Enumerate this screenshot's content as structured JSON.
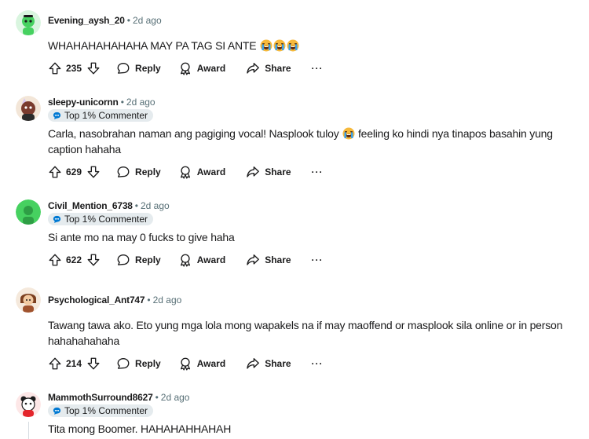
{
  "comments": [
    {
      "username": "Evening_aysh_20",
      "time": "2d ago",
      "badge": "",
      "text": "WHAHAHAHAHAHA MAY PA TAG SI ANTE",
      "upvotes": "235",
      "reply_label": "Reply",
      "award_label": "Award",
      "share_label": "Share",
      "more_label": "···",
      "avatar_color": "#46d160"
    },
    {
      "username": "sleepy-unicornn",
      "time": "2d ago",
      "badge": "Top 1% Commenter",
      "text_before_emoji": "Carla, nasobrahan naman ang pagiging vocal! Nasplook tuloy",
      "text_after_emoji": "feeling ko hindi nya tinapos basahin yung caption hahaha",
      "upvotes": "629",
      "reply_label": "Reply",
      "award_label": "Award",
      "share_label": "Share",
      "more_label": "···",
      "avatar_color": "#7a3b2e"
    },
    {
      "username": "Civil_Mention_6738",
      "time": "2d ago",
      "badge": "Top 1% Commenter",
      "text": "Si ante mo na may 0 fucks to give haha",
      "upvotes": "622",
      "reply_label": "Reply",
      "award_label": "Award",
      "share_label": "Share",
      "more_label": "···",
      "avatar_color": "#46d160"
    },
    {
      "username": "Psychological_Ant747",
      "time": "2d ago",
      "badge": "",
      "text": "Tawang tawa ako. Eto yung mga lola mong wapakels na if may maoffend or masplook sila online or in person hahahahahaha",
      "upvotes": "214",
      "reply_label": "Reply",
      "award_label": "Award",
      "share_label": "Share",
      "more_label": "···",
      "avatar_color": "#a0522d"
    },
    {
      "username": "MammothSurround8627",
      "time": "2d ago",
      "badge": "Top 1% Commenter",
      "text": "Tita mong Boomer. HAHAHAHHAHAH",
      "avatar_color": "#e4252b"
    }
  ],
  "separator": "•",
  "colors": {
    "meta": "#576f76",
    "badge_bg": "#e5ebee",
    "badge_icon": "#0079d3",
    "thread_line": "#d5dce0"
  },
  "icons": {
    "upvote": "upvote-arrow-icon",
    "downvote": "downvote-arrow-icon",
    "reply": "speech-bubble-icon",
    "award": "award-ribbon-icon",
    "share": "share-arrow-icon",
    "badge": "chat-bubble-badge-icon",
    "emoji": "loudly-crying-face-emoji"
  }
}
